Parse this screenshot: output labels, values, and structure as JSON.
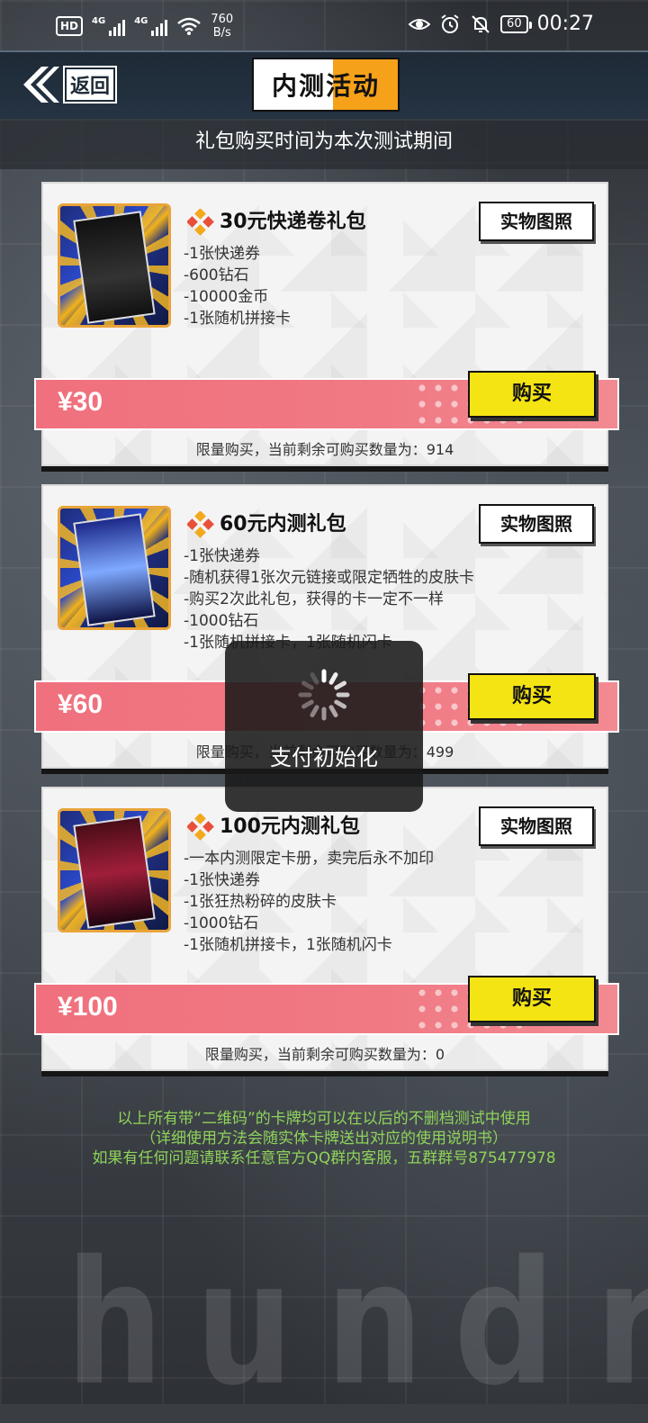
{
  "status_bar": {
    "hd": "HD",
    "net1": "4G",
    "net2": "4G",
    "speed_value": "760",
    "speed_unit": "B/s",
    "battery": "60",
    "time": "00:27"
  },
  "header": {
    "back_label": "返回",
    "title": "内测活动"
  },
  "subtitle": "礼包购买时间为本次测试期间",
  "packs": [
    {
      "title": "30元快递卷礼包",
      "photo_label": "实物图照",
      "items": [
        "-1张快递券",
        "-600钻石",
        "-10000金币",
        "-1张随机拼接卡"
      ],
      "price": "¥30",
      "buy_label": "购买",
      "limit_text": "限量购买，当前剩余可购买数量为：914"
    },
    {
      "title": "60元内测礼包",
      "photo_label": "实物图照",
      "items": [
        "-1张快递券",
        "-随机获得1张次元链接或限定牺牲的皮肤卡",
        "-购买2次此礼包，获得的卡一定不一样",
        "-1000钻石",
        "-1张随机拼接卡，1张随机闪卡"
      ],
      "price": "¥60",
      "buy_label": "购买",
      "limit_text": "限量购买，当前剩余可购买数量为：499"
    },
    {
      "title": "100元内测礼包",
      "photo_label": "实物图照",
      "items": [
        "-一本内测限定卡册，卖完后永不加印",
        "-1张快递券",
        "-1张狂热粉碎的皮肤卡",
        "-1000钻石",
        "-1张随机拼接卡，1张随机闪卡"
      ],
      "price": "¥100",
      "buy_label": "购买",
      "limit_text": "限量购买，当前剩余可购买数量为：0"
    }
  ],
  "notes": [
    "以上所有带“二维码”的卡牌均可以在以后的不删档测试中使用",
    "（详细使用方法会随实体卡牌送出对应的使用说明书）",
    "如果有任何问题请联系任意官方QQ群内客服，五群群号875477978"
  ],
  "background_word": "hundr",
  "loading": {
    "text": "支付初始化"
  },
  "colors": {
    "accent_orange": "#f6a11a",
    "price_pink": "#f0707e",
    "buy_yellow": "#f5e413",
    "note_green": "#8fd35a"
  }
}
